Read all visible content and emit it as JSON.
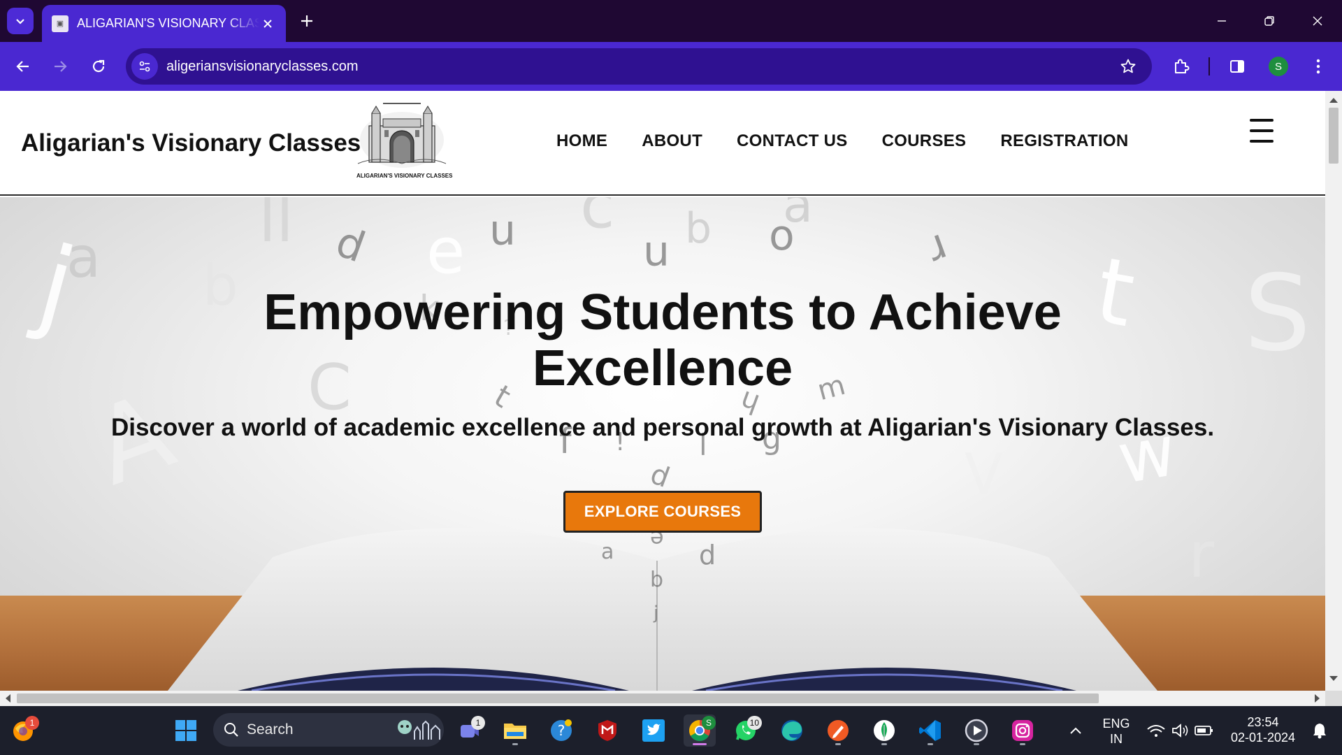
{
  "browser": {
    "tab_title": "ALIGARIAN'S VISIONARY CLASSES",
    "url": "aligeriansvisionaryclasses.com",
    "profile_initial": "S"
  },
  "site": {
    "brand": "Aligarian's Visionary Classes",
    "logo_caption": "ALIGARIAN'S VISIONARY CLASSES",
    "nav": [
      "HOME",
      "ABOUT",
      "CONTACT US",
      "COURSES",
      "REGISTRATION"
    ]
  },
  "hero": {
    "title": "Empowering Students to Achieve Excellence",
    "subtitle": "Discover a world of academic excellence and personal growth at Aligarian's Visionary Classes.",
    "cta": "EXPLORE COURSES"
  },
  "taskbar": {
    "search_placeholder": "Search",
    "badges": {
      "firefox": "1",
      "teams": "1",
      "whatsapp": "10",
      "chrome_profile": "S"
    },
    "language": [
      "ENG",
      "IN"
    ],
    "time": "23:54",
    "date": "02-01-2024"
  },
  "colors": {
    "tabstrip": "#1f0833",
    "toolbar": "#4a28d1",
    "cta": "#e8780c",
    "taskbar": "#1c1f2b"
  }
}
